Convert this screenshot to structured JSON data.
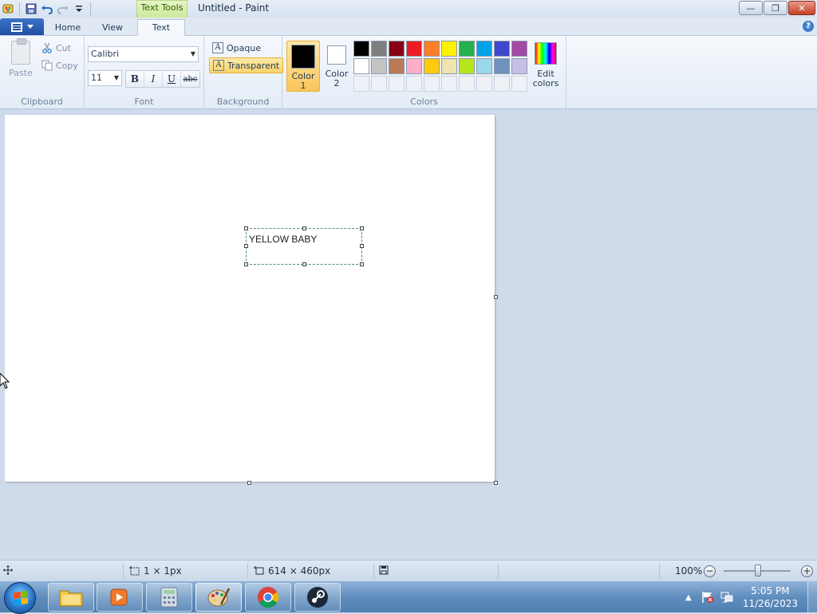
{
  "window": {
    "title": "Untitled - Paint",
    "context_tab": "Text Tools",
    "controls": {
      "minimize": "—",
      "restore": "❐",
      "close": "✕"
    }
  },
  "tabs": [
    {
      "label": "Home",
      "active": false
    },
    {
      "label": "View",
      "active": false
    },
    {
      "label": "Text",
      "active": true
    }
  ],
  "clipboard": {
    "paste": "Paste",
    "cut": "Cut",
    "copy": "Copy",
    "group_label": "Clipboard"
  },
  "font": {
    "family": "Calibri",
    "size": "11",
    "bold": "B",
    "italic": "I",
    "underline": "U",
    "strike": "abc",
    "group_label": "Font"
  },
  "background": {
    "opaque": "Opaque",
    "transparent": "Transparent",
    "selected": "transparent",
    "group_label": "Background"
  },
  "colors": {
    "color1_label_line1": "Color",
    "color1_label_line2": "1",
    "color1_value": "#000000",
    "color2_label_line1": "Color",
    "color2_label_line2": "2",
    "color2_value": "#ffffff",
    "edit_line1": "Edit",
    "edit_line2": "colors",
    "group_label": "Colors",
    "palette_row1": [
      "#000000",
      "#7f7f7f",
      "#880015",
      "#ed1c24",
      "#ff7f27",
      "#fff200",
      "#22b14c",
      "#00a2e8",
      "#3f48cc",
      "#a349a4"
    ],
    "palette_row2": [
      "#ffffff",
      "#c3c3c3",
      "#b97a57",
      "#ffaec9",
      "#ffc90e",
      "#efe4b0",
      "#b5e61d",
      "#99d9ea",
      "#7092be",
      "#c8bfe7"
    ]
  },
  "canvas": {
    "text": "YELLOW BABY"
  },
  "status": {
    "selection_size": "1 × 1px",
    "canvas_size": "614 × 460px",
    "zoom": "100%",
    "zoom_out": "−",
    "zoom_in": "+"
  },
  "taskbar": {
    "time": "5:05 PM",
    "date": "11/26/2023",
    "apps": [
      "file-explorer",
      "media-player",
      "calculator",
      "paint",
      "chrome",
      "steam"
    ]
  }
}
